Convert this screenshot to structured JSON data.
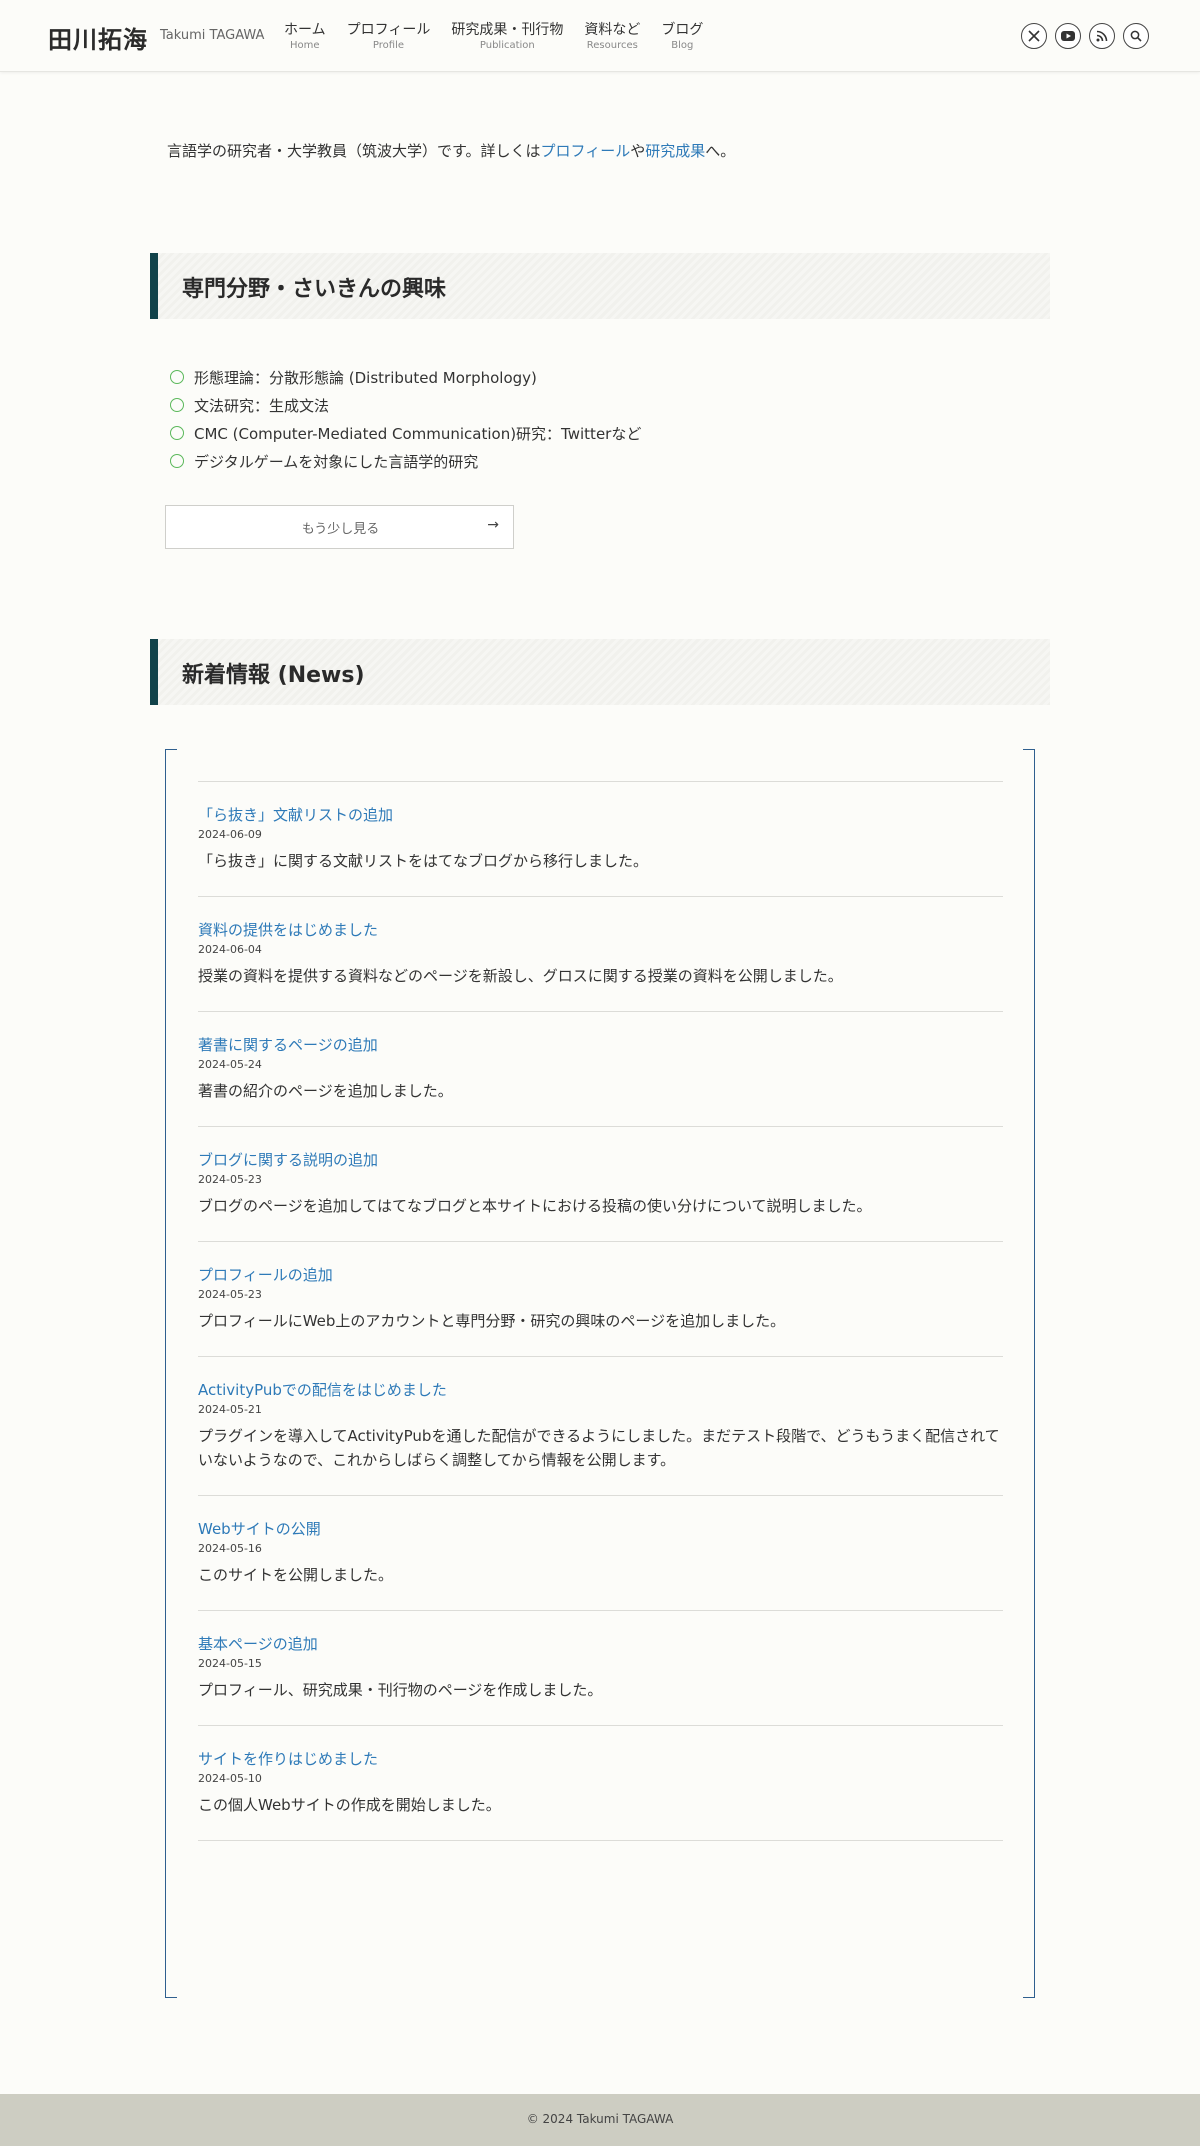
{
  "header": {
    "site_title": "田川拓海",
    "site_subtitle": "Takumi TAGAWA",
    "nav": [
      {
        "label": "ホーム",
        "sub": "Home"
      },
      {
        "label": "プロフィール",
        "sub": "Profile"
      },
      {
        "label": "研究成果・刊行物",
        "sub": "Publication"
      },
      {
        "label": "資料など",
        "sub": "Resources"
      },
      {
        "label": "ブログ",
        "sub": "Blog"
      }
    ],
    "icons": [
      "x-icon",
      "youtube-icon",
      "rss-icon",
      "search-icon"
    ]
  },
  "intro": {
    "text_before": "言語学の研究者・大学教員（筑波大学）です。詳しくは",
    "link_profile": "プロフィール",
    "text_middle": "や",
    "link_research": "研究成果",
    "text_after": "へ。"
  },
  "interests": {
    "heading": "専門分野・さいきんの興味",
    "items": [
      "形態理論：分散形態論 (Distributed Morphology)",
      "文法研究：生成文法",
      "CMC (Computer-Mediated Communication)研究：Twitterなど",
      "デジタルゲームを対象にした言語学的研究"
    ],
    "more_label": "もう少し見る",
    "more_arrow": "→"
  },
  "news": {
    "heading": "新着情報 (News)",
    "items": [
      {
        "title": "「ら抜き」文献リストの追加",
        "date": "2024-06-09",
        "text": "「ら抜き」に関する文献リストをはてなブログから移行しました。"
      },
      {
        "title": "資料の提供をはじめました",
        "date": "2024-06-04",
        "text": "授業の資料を提供する資料などのページを新設し、グロスに関する授業の資料を公開しました。"
      },
      {
        "title": "著書に関するページの追加",
        "date": "2024-05-24",
        "text": "著書の紹介のページを追加しました。"
      },
      {
        "title": "ブログに関する説明の追加",
        "date": "2024-05-23",
        "text": "ブログのページを追加してはてなブログと本サイトにおける投稿の使い分けについて説明しました。"
      },
      {
        "title": "プロフィールの追加",
        "date": "2024-05-23",
        "text": "プロフィールにWeb上のアカウントと専門分野・研究の興味のページを追加しました。"
      },
      {
        "title": "ActivityPubでの配信をはじめました",
        "date": "2024-05-21",
        "text": "プラグインを導入してActivityPubを通した配信ができるようにしました。まだテスト段階で、どうもうまく配信されていないようなので、これからしばらく調整してから情報を公開します。"
      },
      {
        "title": "Webサイトの公開",
        "date": "2024-05-16",
        "text": "このサイトを公開しました。"
      },
      {
        "title": "基本ページの追加",
        "date": "2024-05-15",
        "text": "プロフィール、研究成果・刊行物のページを作成しました。"
      },
      {
        "title": "サイトを作りはじめました",
        "date": "2024-05-10",
        "text": "この個人Webサイトの作成を開始しました。"
      }
    ]
  },
  "footer": {
    "copyright": "© 2024 Takumi TAGAWA"
  }
}
